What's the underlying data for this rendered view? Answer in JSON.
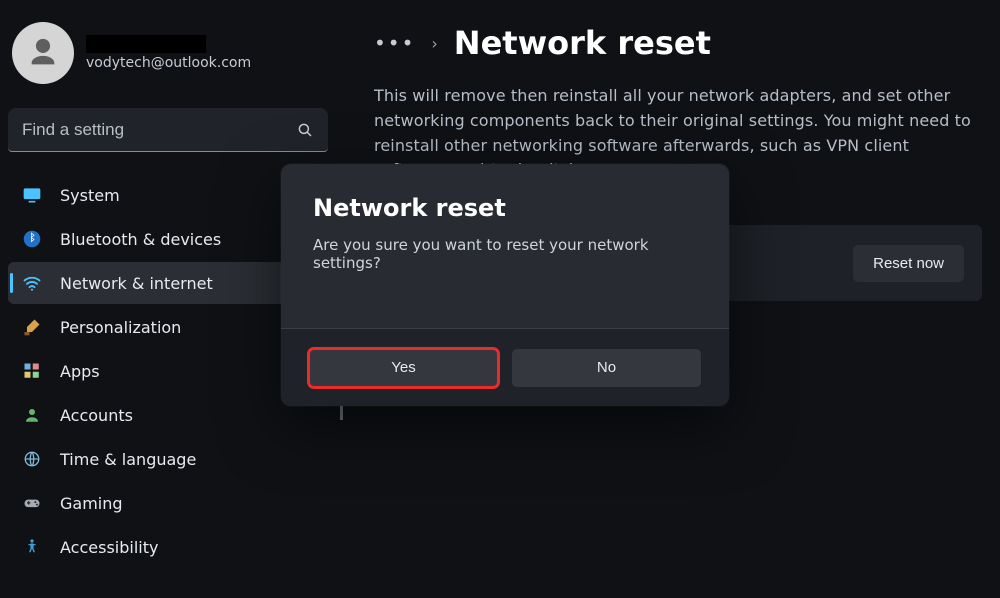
{
  "profile": {
    "email": "vodytech@outlook.com"
  },
  "search": {
    "placeholder": "Find a setting"
  },
  "sidebar": {
    "items": [
      {
        "label": "System",
        "icon": "system-icon"
      },
      {
        "label": "Bluetooth & devices",
        "icon": "bluetooth-icon"
      },
      {
        "label": "Network & internet",
        "icon": "wifi-icon"
      },
      {
        "label": "Personalization",
        "icon": "brush-icon"
      },
      {
        "label": "Apps",
        "icon": "apps-icon"
      },
      {
        "label": "Accounts",
        "icon": "person-icon"
      },
      {
        "label": "Time & language",
        "icon": "globe-icon"
      },
      {
        "label": "Gaming",
        "icon": "gamepad-icon"
      },
      {
        "label": "Accessibility",
        "icon": "accessibility-icon"
      }
    ],
    "selected": 2
  },
  "page": {
    "breadcrumb_more": "•••",
    "title": "Network reset",
    "description": "This will remove then reinstall all your network adapters, and set other networking components back to their original settings. You might need to reinstall other networking software afterwards, such as VPN client software or virtual switches.",
    "reset_button": "Reset now"
  },
  "dialog": {
    "title": "Network reset",
    "message": "Are you sure you want to reset your network settings?",
    "yes": "Yes",
    "no": "No"
  }
}
